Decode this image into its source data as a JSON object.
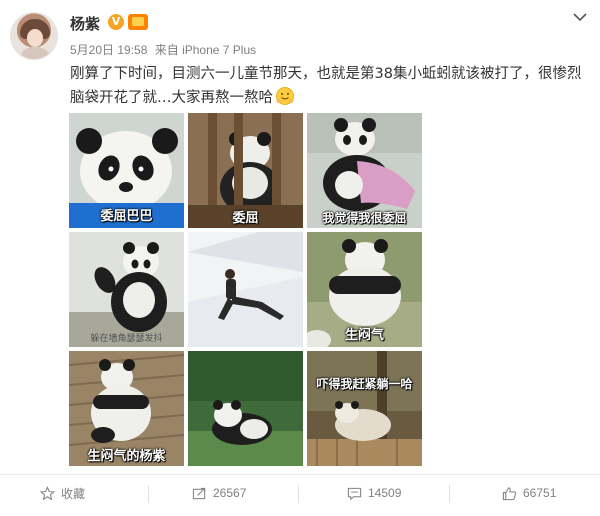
{
  "post": {
    "user_name": "杨紫",
    "verified_mark": "V",
    "timestamp": "5月20日 19:58",
    "source": "来自 iPhone 7 Plus",
    "text_line1": "刚算了下时间，目测六一儿童节那天，也就是第38集小蚯蚓就该被打了，很惨烈",
    "text_line2": "脑袋开花了就…大家再熬一熬哈"
  },
  "images": [
    {
      "caption": "委屈巴巴",
      "caption_bg": "#1e6fd0"
    },
    {
      "caption": "委屈"
    },
    {
      "caption": "我觉得我很委屈"
    },
    {
      "caption": "躲在墙角瑟瑟发抖"
    },
    {
      "caption": ""
    },
    {
      "caption": "生闷气"
    },
    {
      "caption": "生闷气的杨紫"
    },
    {
      "caption": ""
    },
    {
      "caption": "吓得我赶紧躺一哈"
    }
  ],
  "actions": {
    "favorite_label": "收藏",
    "repost_count": "26567",
    "comment_count": "14509",
    "like_count": "66751"
  },
  "icons": [
    "star-icon",
    "repost-icon",
    "comment-icon",
    "like-icon",
    "chevron-down-icon"
  ],
  "colors": {
    "accent": "#ff8200",
    "meta": "#808080",
    "verify": "#f5a623"
  }
}
